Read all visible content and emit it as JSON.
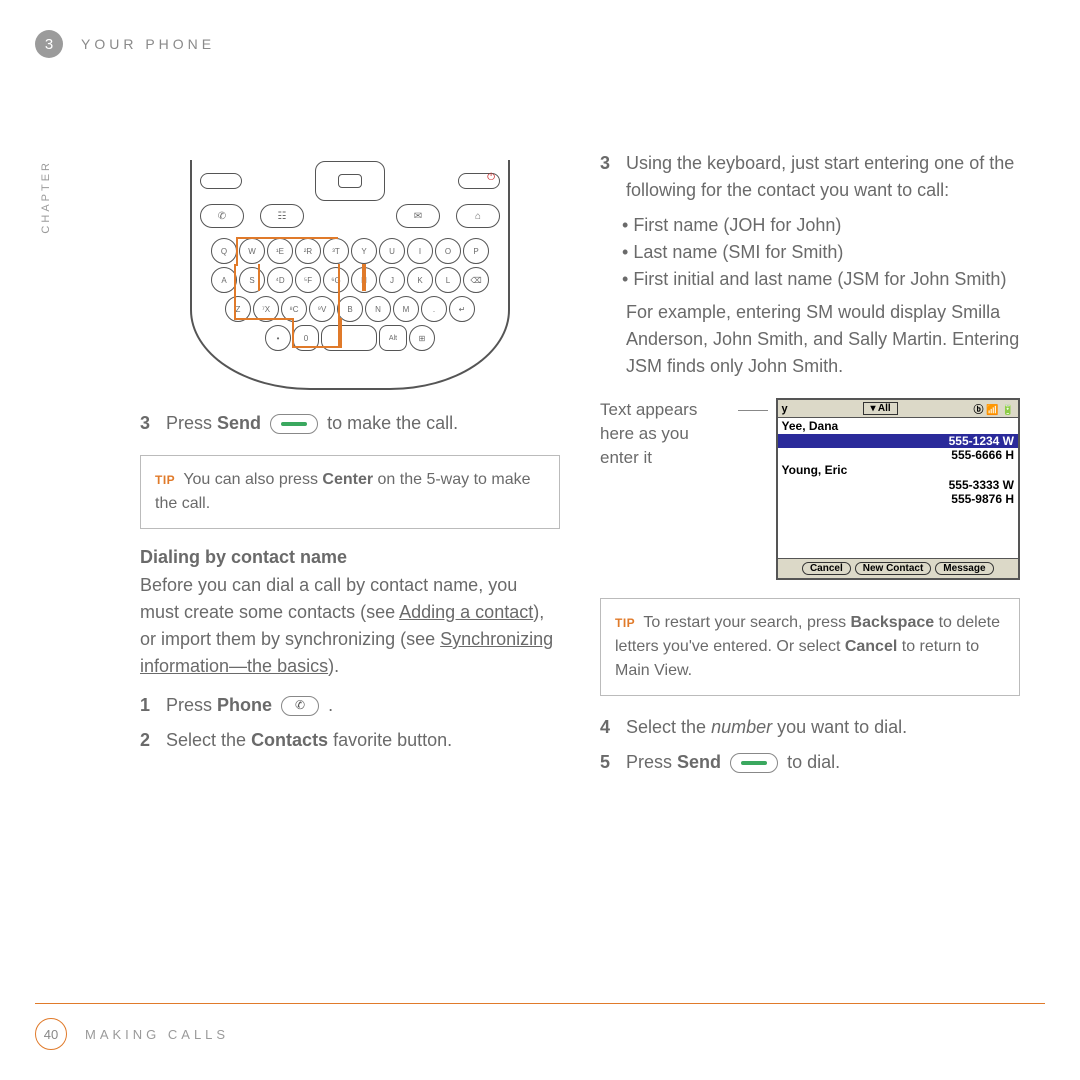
{
  "header": {
    "chapter_num": "3",
    "title": "YOUR PHONE",
    "side_label": "CHAPTER"
  },
  "left": {
    "step3_a": "Press ",
    "step3_bold": "Send",
    "step3_b": " to make the call.",
    "tip1_a": "You can also press ",
    "tip1_bold": "Center",
    "tip1_b": " on the 5-way to make the call.",
    "subhead": "Dialing by contact name",
    "intro_a": "Before you can dial a call by contact name, you must create some contacts (see ",
    "intro_link1": "Adding a contact",
    "intro_b": "), or import them by synchronizing (see ",
    "intro_link2": "Synchronizing information—the basics",
    "intro_c": ").",
    "s1_a": "Press ",
    "s1_bold": "Phone",
    "s1_b": " .",
    "s2_a": "Select the ",
    "s2_bold": "Contacts",
    "s2_b": " favorite button."
  },
  "right": {
    "s3_a": "Using the keyboard, just start entering one of the following for the contact you want to call:",
    "b1": "First name (JOH for John)",
    "b2": "Last name (SMI for Smith)",
    "b3": "First initial and last name (JSM for John Smith)",
    "s3_b": "For example, entering SM would display Smilla Anderson, John Smith, and Sally Martin. Entering JSM finds only John Smith.",
    "callout": "Text appears here as you enter it",
    "screen": {
      "search": "y",
      "filter": "▾ All",
      "c1_name": "Yee, Dana",
      "c1_n1": "555-1234 W",
      "c1_n2": "555-6666 H",
      "c2_name": "Young, Eric",
      "c2_n1": "555-3333 W",
      "c2_n2": "555-9876 H",
      "btn_cancel": "Cancel",
      "btn_new": "New Contact",
      "btn_msg": "Message"
    },
    "tip2_a": "To restart your search, press ",
    "tip2_bold1": "Backspace",
    "tip2_b": " to delete letters you've entered. Or select ",
    "tip2_bold2": "Cancel",
    "tip2_c": " to return to Main View.",
    "s4_a": "Select the ",
    "s4_i": "number",
    "s4_b": " you want to dial.",
    "s5_a": "Press ",
    "s5_bold": "Send",
    "s5_b": " to dial."
  },
  "footer": {
    "page": "40",
    "title": "MAKING CALLS"
  },
  "nums": {
    "n1": "1",
    "n2": "2",
    "n3": "3",
    "n4": "4",
    "n5": "5"
  },
  "tip_label": "TIP"
}
